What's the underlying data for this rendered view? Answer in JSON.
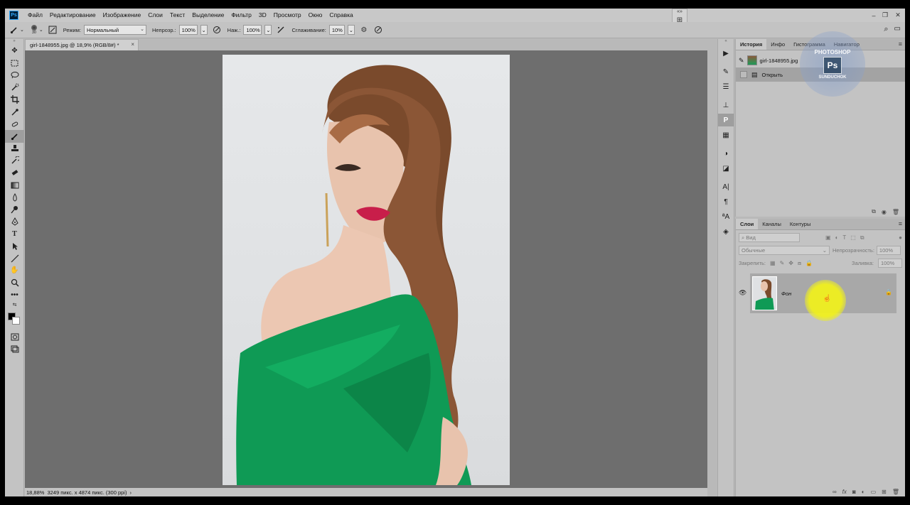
{
  "menubar": {
    "logo": "Ps",
    "items": [
      "Файл",
      "Редактирование",
      "Изображение",
      "Слои",
      "Текст",
      "Выделение",
      "Фильтр",
      "3D",
      "Просмотр",
      "Окно",
      "Справка"
    ]
  },
  "options": {
    "brush_size": "30",
    "mode_label": "Режим:",
    "mode_value": "Нормальный",
    "opacity_label": "Непрозр.:",
    "opacity_value": "100%",
    "pressure_label": "Наж.:",
    "pressure_value": "100%",
    "smoothing_label": "Сглаживание:",
    "smoothing_value": "10%"
  },
  "document": {
    "tab_title": "girl-1848955.jpg @ 18,9% (RGB/8#) *"
  },
  "status": {
    "zoom": "18,88%",
    "info": "3249 пикс. x 4874 пикс. (300 ppi)"
  },
  "history_panel": {
    "tabs": [
      "История",
      "Инфо",
      "Гистограмма",
      "Навигатор"
    ],
    "snapshot_name": "girl-1848955.jpg",
    "step_open": "Открыть"
  },
  "layers_panel": {
    "tabs": [
      "Слои",
      "Каналы",
      "Контуры"
    ],
    "filter_placeholder": "Вид",
    "blend_mode": "Обычные",
    "opacity_label": "Непрозрачность:",
    "opacity_value": "100%",
    "lock_label": "Закрепить:",
    "fill_label": "Заливка:",
    "fill_value": "100%",
    "layer_name": "Фон"
  },
  "watermark": {
    "top_text": "PHOTOSHOP",
    "logo": "Ps",
    "bottom_text": "SUNDUCHOK"
  },
  "colors": {
    "cursor_highlight": "#f0f01e",
    "dress": "#0f9a55",
    "hair": "#7a4a2c",
    "lips": "#c81e4a"
  }
}
